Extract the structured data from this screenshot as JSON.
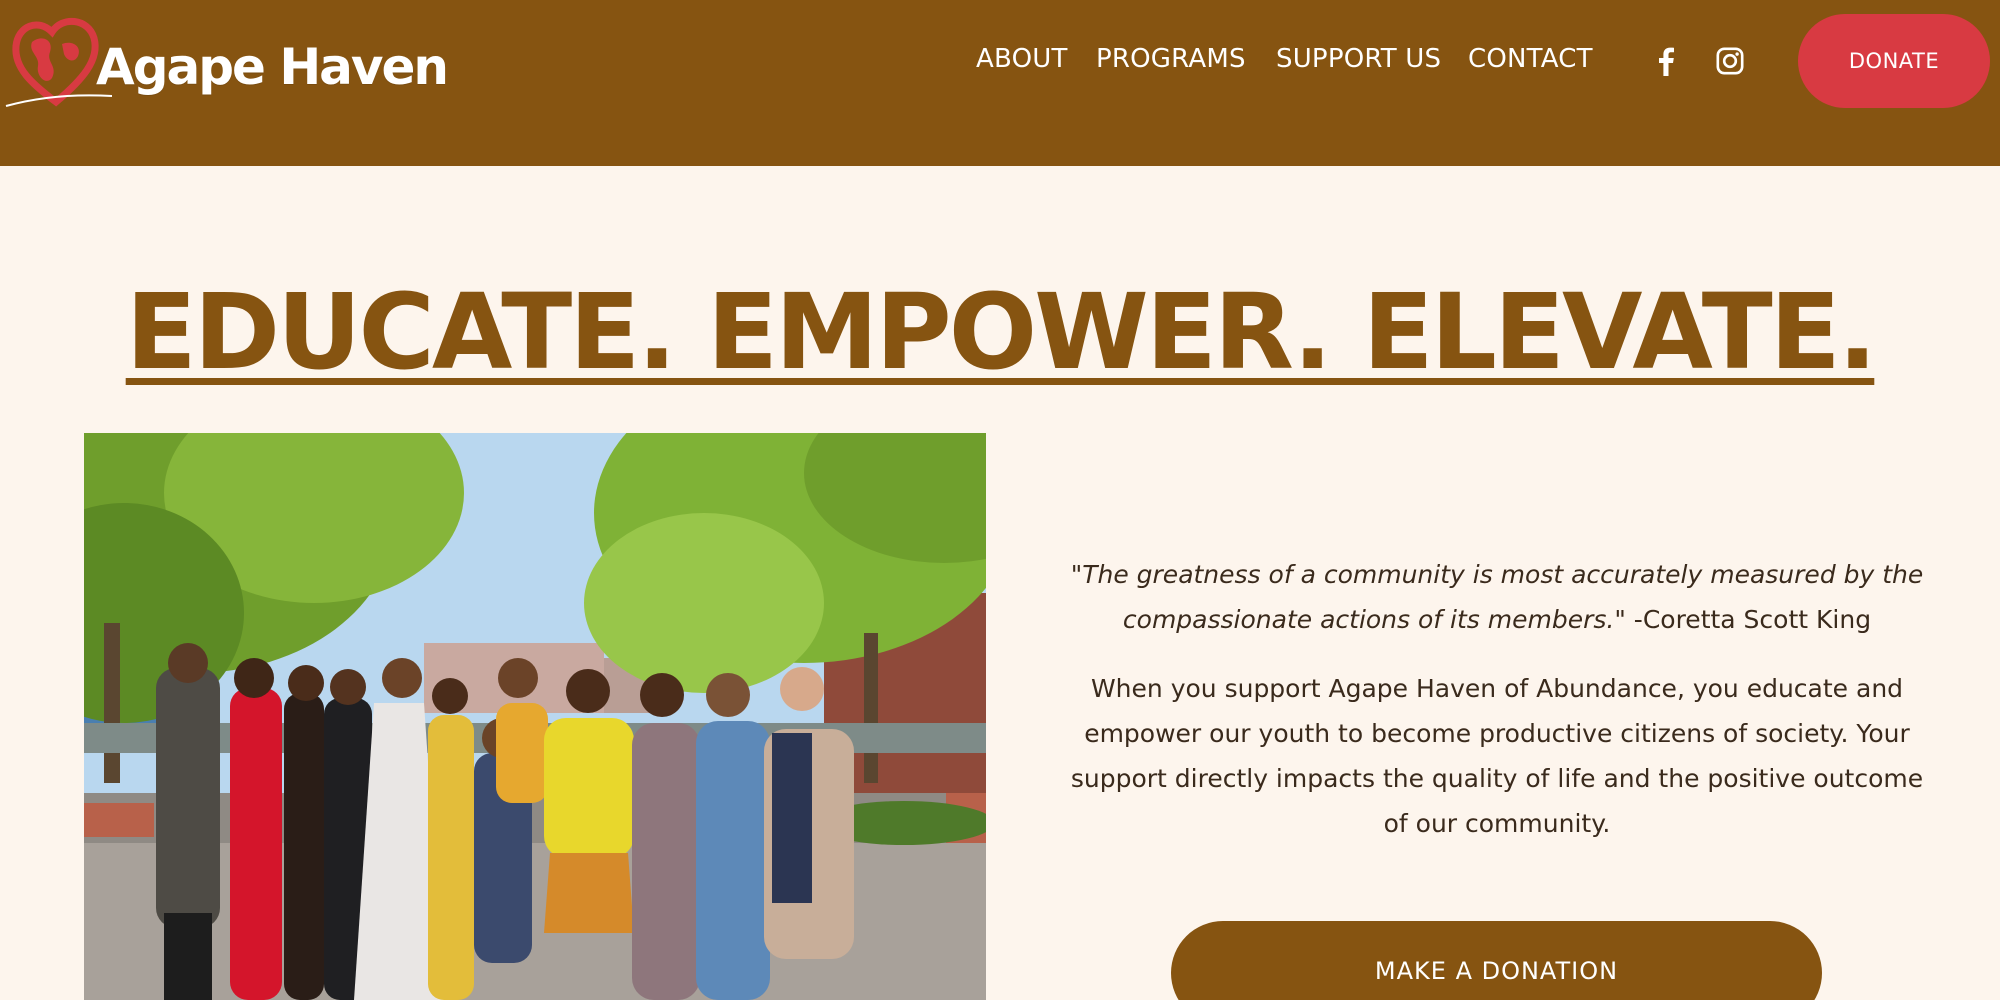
{
  "brand": {
    "name": "Agape Haven",
    "logo_icon": "heart-globe-icon",
    "colors": {
      "header": "#865411",
      "accent": "#d83a42",
      "background": "#fdf5ed"
    }
  },
  "nav": {
    "items": [
      {
        "label": "ABOUT"
      },
      {
        "label": "PROGRAMS"
      },
      {
        "label": "SUPPORT US"
      },
      {
        "label": "CONTACT"
      }
    ],
    "social": [
      {
        "icon": "facebook-icon"
      },
      {
        "icon": "instagram-icon"
      }
    ],
    "donate_label": "DONATE"
  },
  "hero": {
    "headline": "EDUCATE. EMPOWER. ELEVATE.",
    "quote_text": "\"The greatness of a community is most accurately measured by the compassionate actions of its members.\"",
    "quote_author": " -Coretta Scott King",
    "body": "When you support Agape Haven of Abundance, you educate and empower our youth to become productive citizens of society. Your support directly impacts the quality of life and the positive outcome of our community.",
    "cta_label": "MAKE A DONATION"
  }
}
